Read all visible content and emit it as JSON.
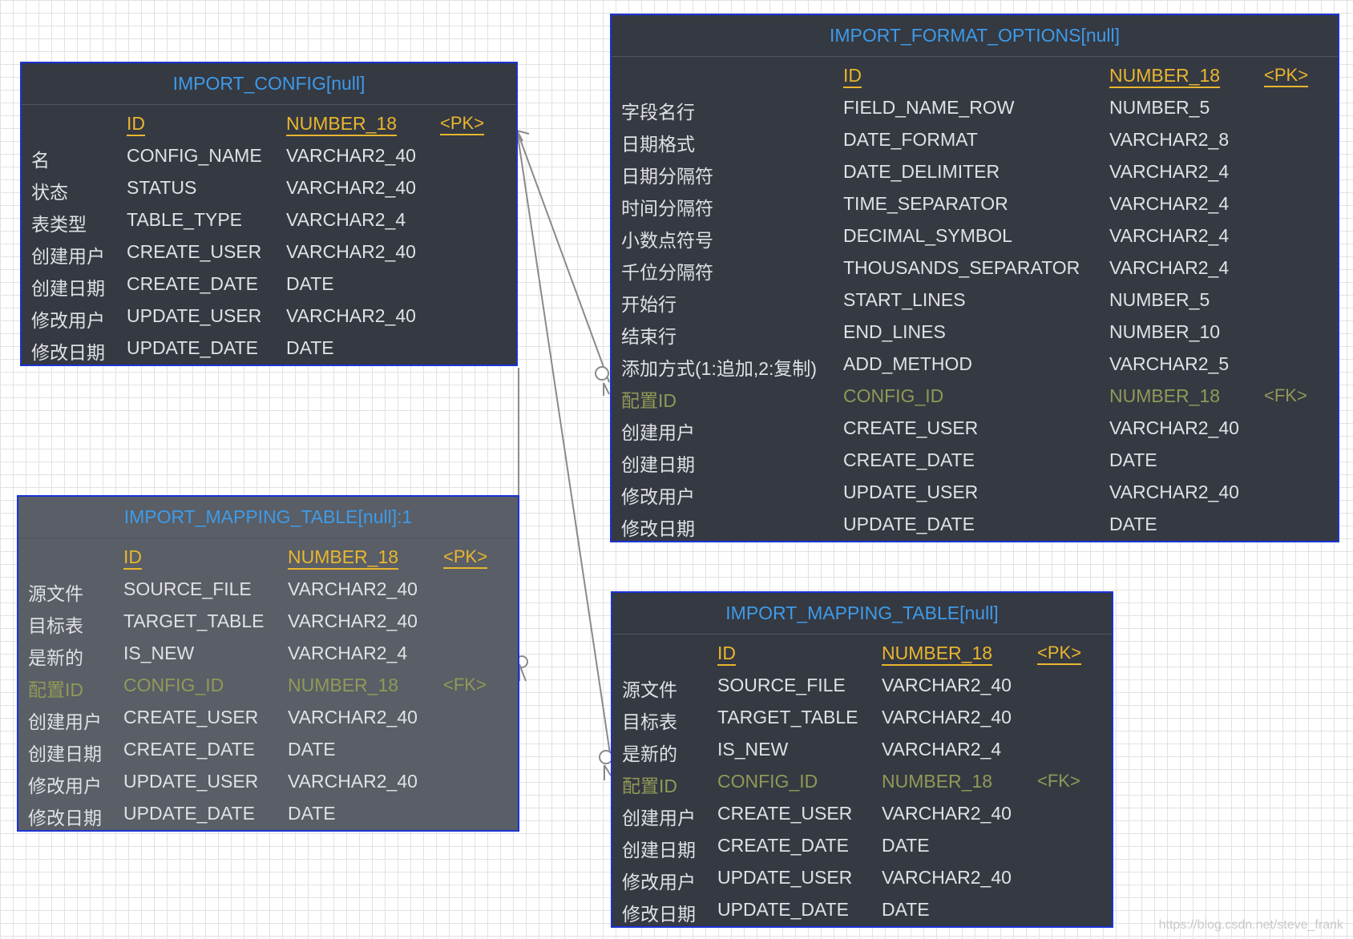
{
  "entities": [
    {
      "id": "import_config",
      "title": "IMPORT_CONFIG[null]",
      "selected": false,
      "rows": [
        {
          "label": "",
          "name": "ID",
          "type": "NUMBER_18",
          "key": "<PK>"
        },
        {
          "label": "名",
          "name": "CONFIG_NAME",
          "type": "VARCHAR2_40",
          "key": ""
        },
        {
          "label": "状态",
          "name": "STATUS",
          "type": "VARCHAR2_40",
          "key": ""
        },
        {
          "label": "表类型",
          "name": "TABLE_TYPE",
          "type": "VARCHAR2_4",
          "key": ""
        },
        {
          "label": "创建用户",
          "name": "CREATE_USER",
          "type": "VARCHAR2_40",
          "key": ""
        },
        {
          "label": "创建日期",
          "name": "CREATE_DATE",
          "type": "DATE",
          "key": ""
        },
        {
          "label": "修改用户",
          "name": "UPDATE_USER",
          "type": "VARCHAR2_40",
          "key": ""
        },
        {
          "label": "修改日期",
          "name": "UPDATE_DATE",
          "type": "DATE",
          "key": ""
        }
      ]
    },
    {
      "id": "import_format_options",
      "title": "IMPORT_FORMAT_OPTIONS[null]",
      "selected": false,
      "rows": [
        {
          "label": "",
          "name": "ID",
          "type": "NUMBER_18",
          "key": "<PK>"
        },
        {
          "label": "字段名行",
          "name": "FIELD_NAME_ROW",
          "type": "NUMBER_5",
          "key": ""
        },
        {
          "label": "日期格式",
          "name": "DATE_FORMAT",
          "type": "VARCHAR2_8",
          "key": ""
        },
        {
          "label": "日期分隔符",
          "name": "DATE_DELIMITER",
          "type": "VARCHAR2_4",
          "key": ""
        },
        {
          "label": "时间分隔符",
          "name": "TIME_SEPARATOR",
          "type": "VARCHAR2_4",
          "key": ""
        },
        {
          "label": "小数点符号",
          "name": "DECIMAL_SYMBOL",
          "type": "VARCHAR2_4",
          "key": ""
        },
        {
          "label": "千位分隔符",
          "name": "THOUSANDS_SEPARATOR",
          "type": "VARCHAR2_4",
          "key": ""
        },
        {
          "label": "开始行",
          "name": "START_LINES",
          "type": "NUMBER_5",
          "key": ""
        },
        {
          "label": "结束行",
          "name": "END_LINES",
          "type": "NUMBER_10",
          "key": ""
        },
        {
          "label": "添加方式(1:追加,2:复制)",
          "name": "ADD_METHOD",
          "type": "VARCHAR2_5",
          "key": ""
        },
        {
          "label": "配置ID",
          "name": "CONFIG_ID",
          "type": "NUMBER_18",
          "key": "<FK>"
        },
        {
          "label": "创建用户",
          "name": "CREATE_USER",
          "type": "VARCHAR2_40",
          "key": ""
        },
        {
          "label": "创建日期",
          "name": "CREATE_DATE",
          "type": "DATE",
          "key": ""
        },
        {
          "label": "修改用户",
          "name": "UPDATE_USER",
          "type": "VARCHAR2_40",
          "key": ""
        },
        {
          "label": "修改日期",
          "name": "UPDATE_DATE",
          "type": "DATE",
          "key": ""
        }
      ]
    },
    {
      "id": "import_mapping_table_1",
      "title": "IMPORT_MAPPING_TABLE[null]:1",
      "selected": true,
      "rows": [
        {
          "label": "",
          "name": "ID",
          "type": "NUMBER_18",
          "key": "<PK>"
        },
        {
          "label": "源文件",
          "name": "SOURCE_FILE",
          "type": "VARCHAR2_40",
          "key": ""
        },
        {
          "label": "目标表",
          "name": "TARGET_TABLE",
          "type": "VARCHAR2_40",
          "key": ""
        },
        {
          "label": "是新的",
          "name": "IS_NEW",
          "type": "VARCHAR2_4",
          "key": ""
        },
        {
          "label": "配置ID",
          "name": "CONFIG_ID",
          "type": "NUMBER_18",
          "key": "<FK>"
        },
        {
          "label": "创建用户",
          "name": "CREATE_USER",
          "type": "VARCHAR2_40",
          "key": ""
        },
        {
          "label": "创建日期",
          "name": "CREATE_DATE",
          "type": "DATE",
          "key": ""
        },
        {
          "label": "修改用户",
          "name": "UPDATE_USER",
          "type": "VARCHAR2_40",
          "key": ""
        },
        {
          "label": "修改日期",
          "name": "UPDATE_DATE",
          "type": "DATE",
          "key": ""
        }
      ]
    },
    {
      "id": "import_mapping_table",
      "title": "IMPORT_MAPPING_TABLE[null]",
      "selected": false,
      "rows": [
        {
          "label": "",
          "name": "ID",
          "type": "NUMBER_18",
          "key": "<PK>"
        },
        {
          "label": "源文件",
          "name": "SOURCE_FILE",
          "type": "VARCHAR2_40",
          "key": ""
        },
        {
          "label": "目标表",
          "name": "TARGET_TABLE",
          "type": "VARCHAR2_40",
          "key": ""
        },
        {
          "label": "是新的",
          "name": "IS_NEW",
          "type": "VARCHAR2_4",
          "key": ""
        },
        {
          "label": "配置ID",
          "name": "CONFIG_ID",
          "type": "NUMBER_18",
          "key": "<FK>"
        },
        {
          "label": "创建用户",
          "name": "CREATE_USER",
          "type": "VARCHAR2_40",
          "key": ""
        },
        {
          "label": "创建日期",
          "name": "CREATE_DATE",
          "type": "DATE",
          "key": ""
        },
        {
          "label": "修改用户",
          "name": "UPDATE_USER",
          "type": "VARCHAR2_40",
          "key": ""
        },
        {
          "label": "修改日期",
          "name": "UPDATE_DATE",
          "type": "DATE",
          "key": ""
        }
      ]
    }
  ],
  "relationships": [
    {
      "from": "import_config",
      "to": "import_format_options",
      "type": "one-to-many"
    },
    {
      "from": "import_config",
      "to": "import_mapping_table",
      "type": "one-to-many"
    },
    {
      "from": "import_config",
      "to": "import_mapping_table_1",
      "type": "one-to-many"
    }
  ],
  "watermark": "https://blog.csdn.net/steve_frank",
  "colors": {
    "canvas_background": "#ffffff",
    "grid_line": "#e2e2e2",
    "entity_background": "#353942",
    "entity_selected_background": "#5a5e66",
    "entity_border": "#1a33d6",
    "title_text": "#3d9be9",
    "column_text": "#dfe1e4",
    "primary_key": "#e9b62e",
    "foreign_key": "#8f9a57",
    "connector": "#8a8a8a"
  }
}
